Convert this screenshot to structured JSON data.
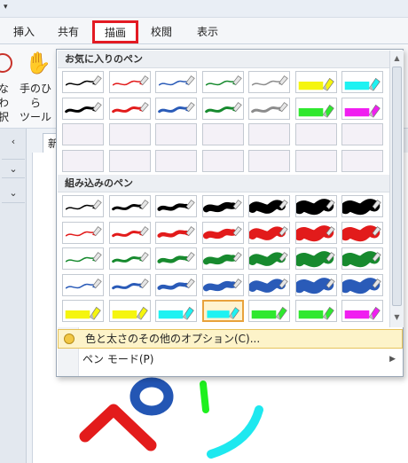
{
  "ribbon": {
    "tabs": [
      {
        "label": "挿入"
      },
      {
        "label": "共有"
      },
      {
        "label": "描画"
      },
      {
        "label": "校閲"
      },
      {
        "label": "表示"
      }
    ],
    "lasso_label": "なわ\n択",
    "hand_label": "手のひら\nツール"
  },
  "nav": {
    "back_icon": "chevron-left-icon",
    "page_tab": "新"
  },
  "pen_menu": {
    "favorites_header": "お気に入りのペン",
    "builtin_header": "組み込みのペン",
    "more_options_label": "色と太さのその他のオプション(C)...",
    "pen_mode_label": "ペン モード(P)",
    "selected_cell": "builtin row 5 col 4 (cyan highlighter)",
    "favorites": [
      [
        {
          "color": "#000000",
          "w": 1
        },
        {
          "color": "#e21b1b",
          "w": 1
        },
        {
          "color": "#2a5bb8",
          "w": 1
        },
        {
          "color": "#178a2e",
          "w": 1
        },
        {
          "color": "#8c8c8c",
          "w": 1
        },
        {
          "color": "#f5f50f",
          "w": 8,
          "hl": true
        },
        {
          "color": "#1ef2f2",
          "w": 8,
          "hl": true
        }
      ],
      [
        {
          "color": "#000000",
          "w": 2
        },
        {
          "color": "#e21b1b",
          "w": 2
        },
        {
          "color": "#2a5bb8",
          "w": 2
        },
        {
          "color": "#178a2e",
          "w": 2
        },
        {
          "color": "#8c8c8c",
          "w": 2
        },
        {
          "color": "#2fe82f",
          "w": 8,
          "hl": true
        },
        {
          "color": "#f01ef0",
          "w": 8,
          "hl": true
        }
      ],
      [
        {
          "empty": true
        },
        {
          "empty": true
        },
        {
          "empty": true
        },
        {
          "empty": true
        },
        {
          "empty": true
        },
        {
          "empty": true
        },
        {
          "empty": true
        }
      ],
      [
        {
          "empty": true
        },
        {
          "empty": true
        },
        {
          "empty": true
        },
        {
          "empty": true
        },
        {
          "empty": true
        },
        {
          "empty": true
        },
        {
          "empty": true
        }
      ]
    ],
    "builtin": [
      [
        {
          "color": "#000000",
          "w": 1
        },
        {
          "color": "#000000",
          "w": 2
        },
        {
          "color": "#000000",
          "w": 3
        },
        {
          "color": "#000000",
          "w": 5
        },
        {
          "color": "#000000",
          "w": 7
        },
        {
          "color": "#000000",
          "w": 9
        },
        {
          "color": "#000000",
          "w": 12
        }
      ],
      [
        {
          "color": "#e21b1b",
          "w": 1
        },
        {
          "color": "#e21b1b",
          "w": 2
        },
        {
          "color": "#e21b1b",
          "w": 3
        },
        {
          "color": "#e21b1b",
          "w": 5
        },
        {
          "color": "#e21b1b",
          "w": 7
        },
        {
          "color": "#e21b1b",
          "w": 9
        },
        {
          "color": "#e21b1b",
          "w": 12
        }
      ],
      [
        {
          "color": "#178a2e",
          "w": 1
        },
        {
          "color": "#178a2e",
          "w": 2
        },
        {
          "color": "#178a2e",
          "w": 3
        },
        {
          "color": "#178a2e",
          "w": 5
        },
        {
          "color": "#178a2e",
          "w": 7
        },
        {
          "color": "#178a2e",
          "w": 9
        },
        {
          "color": "#178a2e",
          "w": 12
        }
      ],
      [
        {
          "color": "#2a5bb8",
          "w": 1
        },
        {
          "color": "#2a5bb8",
          "w": 2
        },
        {
          "color": "#2a5bb8",
          "w": 3
        },
        {
          "color": "#2a5bb8",
          "w": 5
        },
        {
          "color": "#2a5bb8",
          "w": 7
        },
        {
          "color": "#2a5bb8",
          "w": 9
        },
        {
          "color": "#2a5bb8",
          "w": 12
        }
      ],
      [
        {
          "color": "#f5f50f",
          "w": 8,
          "hl": true
        },
        {
          "color": "#f5f50f",
          "w": 8,
          "hl": true
        },
        {
          "color": "#1ef2f2",
          "w": 8,
          "hl": true
        },
        {
          "color": "#1ef2f2",
          "w": 8,
          "hl": true,
          "selected": true
        },
        {
          "color": "#2fe82f",
          "w": 8,
          "hl": true
        },
        {
          "color": "#2fe82f",
          "w": 8,
          "hl": true
        },
        {
          "color": "#f01ef0",
          "w": 8,
          "hl": true
        }
      ]
    ]
  },
  "canvas_ink": {
    "strokes": [
      {
        "color": "#e31b1b"
      },
      {
        "color": "#2356b4"
      },
      {
        "color": "#1ef01e"
      },
      {
        "color": "#1ee8ef"
      }
    ]
  }
}
